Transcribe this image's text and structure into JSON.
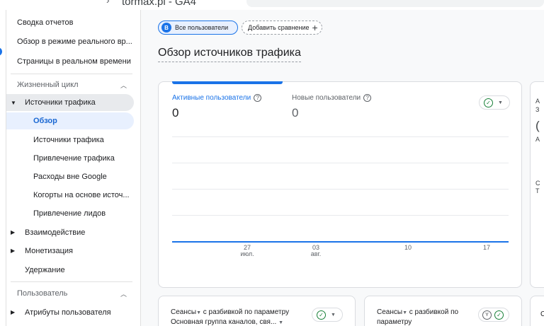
{
  "topbar": {
    "property_name": "tormax.pl - GA4"
  },
  "sidebar": {
    "top_items": [
      {
        "label": "Сводка отчетов"
      },
      {
        "label": "Обзор в режиме реального вр..."
      },
      {
        "label": "Страницы в реальном времени"
      }
    ],
    "lifecycle": {
      "label": "Жизненный цикл",
      "groups": {
        "acquisition": {
          "label": "Источники трафика",
          "children": [
            {
              "label": "Обзор"
            },
            {
              "label": "Источники трафика"
            },
            {
              "label": "Привлечение трафика"
            },
            {
              "label": "Расходы вне Google"
            },
            {
              "label": "Когорты на основе источ..."
            },
            {
              "label": "Привлечение лидов"
            }
          ]
        },
        "engagement": {
          "label": "Взаимодействие"
        },
        "monetization": {
          "label": "Монетизация"
        },
        "retention": {
          "label": "Удержание"
        }
      }
    },
    "user": {
      "label": "Пользователь",
      "attributes": {
        "label": "Атрибуты пользователя"
      }
    }
  },
  "main": {
    "segment_chip": {
      "badge": "B",
      "label": "Все пользователи"
    },
    "add_comparison": {
      "label": "Добавить сравнение"
    },
    "title": "Обзор источников трафика",
    "overview_card": {
      "metrics": [
        {
          "label": "Активные пользователи",
          "value": "0",
          "color": "#1a73e8"
        },
        {
          "label": "Новые пользователи",
          "value": "0",
          "color": "#5f6368"
        }
      ]
    },
    "side_card": {
      "fragments": [
        "А",
        "З",
        "(",
        "А",
        "С",
        "Т"
      ]
    },
    "bottom_cards": [
      {
        "title_line1": "Сеансы",
        "title_line1_rest": " с разбивкой по параметру",
        "title_line2": "Основная группа каналов, свя..."
      },
      {
        "title_line1": "Сеансы",
        "title_line1_rest": " с разбивкой по",
        "title_line2": "параметру",
        "filter_icon_label": "Y"
      },
      {
        "fragment": "С"
      }
    ]
  },
  "chart_data": {
    "type": "line",
    "x": [
      "27 июл.",
      "03 авг.",
      "10",
      "17"
    ],
    "series": [
      {
        "name": "Активные пользователи",
        "values": [
          0,
          0,
          0,
          0
        ]
      }
    ]
  },
  "colors": {
    "accent": "#1a73e8",
    "success": "#188038"
  },
  "icons": {
    "segment_badge": "letter-badge-icon",
    "add": "plus-icon",
    "help": "question-circle-icon",
    "status": "check-circle-icon",
    "dropdown": "chevron-down-icon",
    "filter": "filter-icon"
  }
}
